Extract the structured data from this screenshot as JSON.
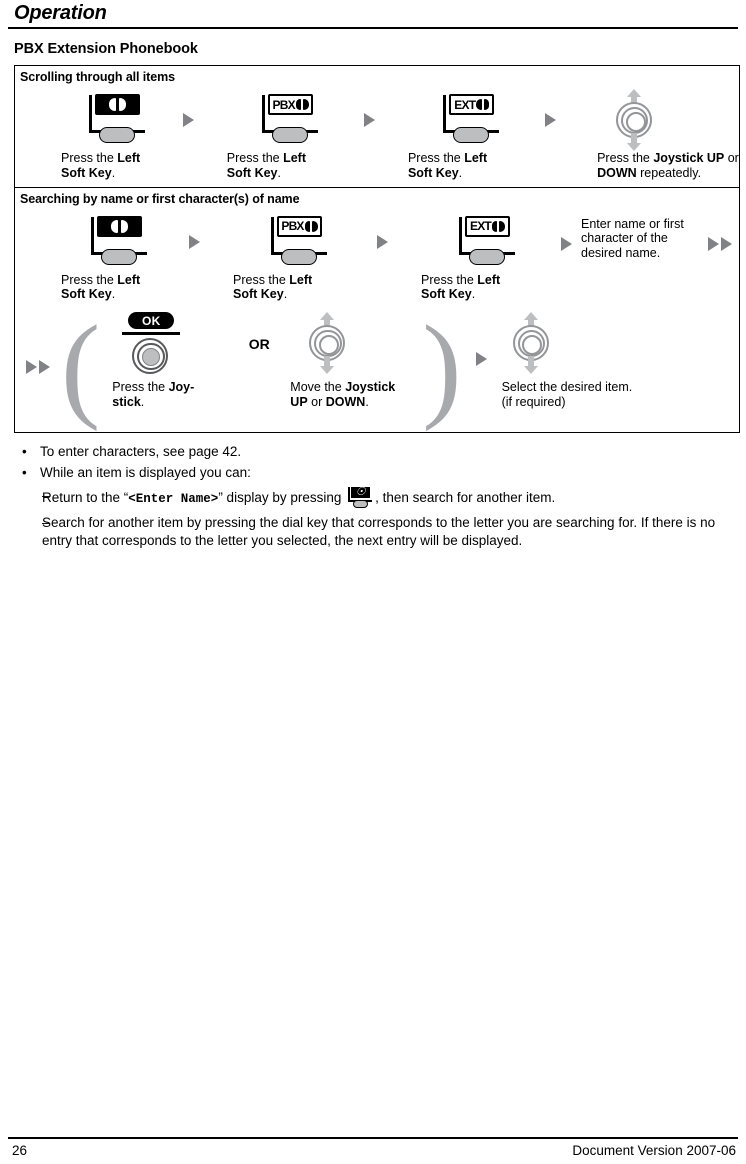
{
  "running_head": "Operation",
  "section_title": "PBX Extension Phonebook",
  "footer": {
    "page_number": "26",
    "document_version": "Document Version 2007-06"
  },
  "colors": {
    "arrow_gray": "#808285",
    "key_gray": "#bcbec0",
    "ring_gray": "#939598",
    "paren_gray": "#a7a9ac",
    "black": "#000000"
  },
  "procedure": {
    "bands": [
      {
        "title": "Scrolling through all items",
        "steps": [
          {
            "icon": "phonebook-softkey-icon",
            "icon_label": "",
            "icon_style": "filled-book",
            "caption_parts": [
              {
                "text": "Press the ",
                "bold": false
              },
              {
                "text": "Left Soft Key",
                "bold": true
              },
              {
                "text": ".",
                "bold": false
              }
            ]
          },
          {
            "icon": "pbx-phonebook-softkey-icon",
            "icon_label": "PBX",
            "icon_style": "outline-book",
            "caption_parts": [
              {
                "text": "Press the ",
                "bold": false
              },
              {
                "text": "Left Soft Key",
                "bold": true
              },
              {
                "text": ".",
                "bold": false
              }
            ]
          },
          {
            "icon": "ext-phonebook-softkey-icon",
            "icon_label": "EXT",
            "icon_style": "outline-book",
            "caption_parts": [
              {
                "text": "Press the ",
                "bold": false
              },
              {
                "text": "Left Soft Key",
                "bold": true
              },
              {
                "text": ".",
                "bold": false
              }
            ]
          },
          {
            "icon": "joystick-up-down-icon",
            "icon_label": "",
            "icon_style": "joystick",
            "caption_parts": [
              {
                "text": "Press the ",
                "bold": false
              },
              {
                "text": "Joystick UP",
                "bold": true
              },
              {
                "text": " or ",
                "bold": false
              },
              {
                "text": "DOWN",
                "bold": true
              },
              {
                "text": " repeatedly.",
                "bold": false
              }
            ]
          }
        ]
      },
      {
        "title": "Searching by name or first character(s) of name",
        "steps": [
          {
            "icon": "phonebook-softkey-icon",
            "icon_label": "",
            "icon_style": "filled-book",
            "caption_parts": [
              {
                "text": "Press the ",
                "bold": false
              },
              {
                "text": "Left Soft Key",
                "bold": true
              },
              {
                "text": ".",
                "bold": false
              }
            ]
          },
          {
            "icon": "pbx-phonebook-softkey-icon",
            "icon_label": "PBX",
            "icon_style": "outline-book",
            "caption_parts": [
              {
                "text": "Press the ",
                "bold": false
              },
              {
                "text": "Left Soft Key",
                "bold": true
              },
              {
                "text": ".",
                "bold": false
              }
            ]
          },
          {
            "icon": "ext-phonebook-softkey-icon",
            "icon_label": "EXT",
            "icon_style": "outline-book",
            "caption_parts": [
              {
                "text": "Press the ",
                "bold": false
              },
              {
                "text": "Left Soft Key",
                "bold": true
              },
              {
                "text": ".",
                "bold": false
              }
            ]
          }
        ],
        "text_step": "Enter name or first character of the desired name."
      }
    ],
    "continued_row": {
      "or_label": "OR",
      "option_a": {
        "icon": "ok-joystick-press-icon",
        "ok_label": "OK",
        "caption_parts": [
          {
            "text": "Press the ",
            "bold": false
          },
          {
            "text": "Joy-stick",
            "bold": true
          },
          {
            "text": ".",
            "bold": false
          }
        ]
      },
      "option_b": {
        "icon": "joystick-up-down-icon",
        "caption_parts": [
          {
            "text": "Move the ",
            "bold": false
          },
          {
            "text": "Joystick UP",
            "bold": true
          },
          {
            "text": " or ",
            "bold": false
          },
          {
            "text": "DOWN",
            "bold": true
          },
          {
            "text": ".",
            "bold": false
          }
        ]
      },
      "final_step": {
        "icon": "joystick-up-down-icon",
        "caption": "Select the desired item. (if required)"
      }
    }
  },
  "notes": {
    "bullet1": "To enter characters, see page 42.",
    "bullet2": "While an item is displayed you can:",
    "sub1_before": "Return to the “",
    "sub1_mono": "<Enter Name>",
    "sub1_mid": "” display by pressing ",
    "sub1_after": ", then search for another item.",
    "sub2": "Search for another item by pressing the dial key that corresponds to the letter you are searching for. If there is no entry that corresponds to the letter you selected, the next entry will be displayed."
  },
  "captions": {
    "press_left_soft_key_1": "Press the Left Soft Key.",
    "press_left_soft_key_2": "Press the Left Soft Key.",
    "press_left_soft_key_3": "Press the Left Soft Key."
  }
}
